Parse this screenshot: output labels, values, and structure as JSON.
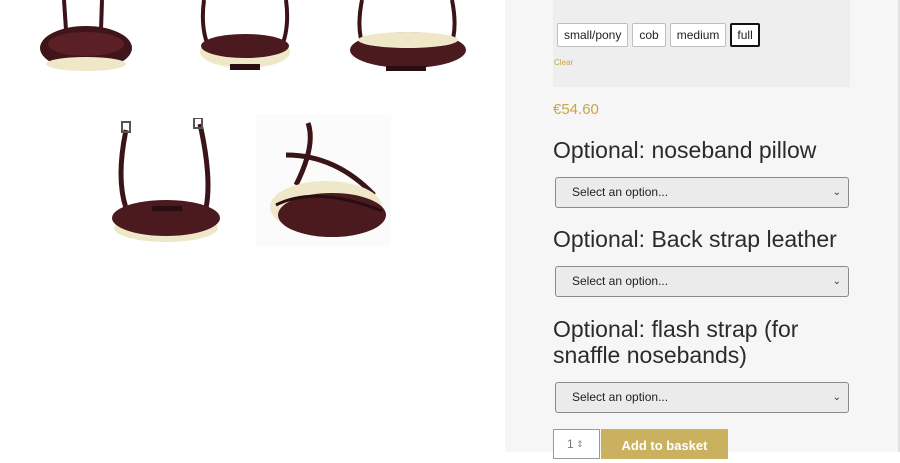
{
  "gallery": {
    "images": [
      {
        "name": "noseband-image-1"
      },
      {
        "name": "noseband-image-2"
      },
      {
        "name": "noseband-image-3"
      },
      {
        "name": "noseband-image-4"
      },
      {
        "name": "noseband-image-5"
      }
    ]
  },
  "product": {
    "sizes": [
      "small/pony",
      "cob",
      "medium",
      "full"
    ],
    "selected_size": "full",
    "clear_label": "Clear",
    "price": "€54.60",
    "options": [
      {
        "title": "Optional: noseband pillow",
        "select_value": "Select an option..."
      },
      {
        "title": "Optional: Back strap leather",
        "select_value": "Select an option..."
      },
      {
        "title": "Optional: flash strap (for snaffle nosebands)",
        "select_value": "Select an option..."
      }
    ],
    "quantity": "1",
    "add_to_basket_label": "Add to basket"
  },
  "colors": {
    "accent": "#c9a54a",
    "button": "#c9b15f",
    "leather": "#4a1a1f",
    "padding": "#efe8c8"
  }
}
